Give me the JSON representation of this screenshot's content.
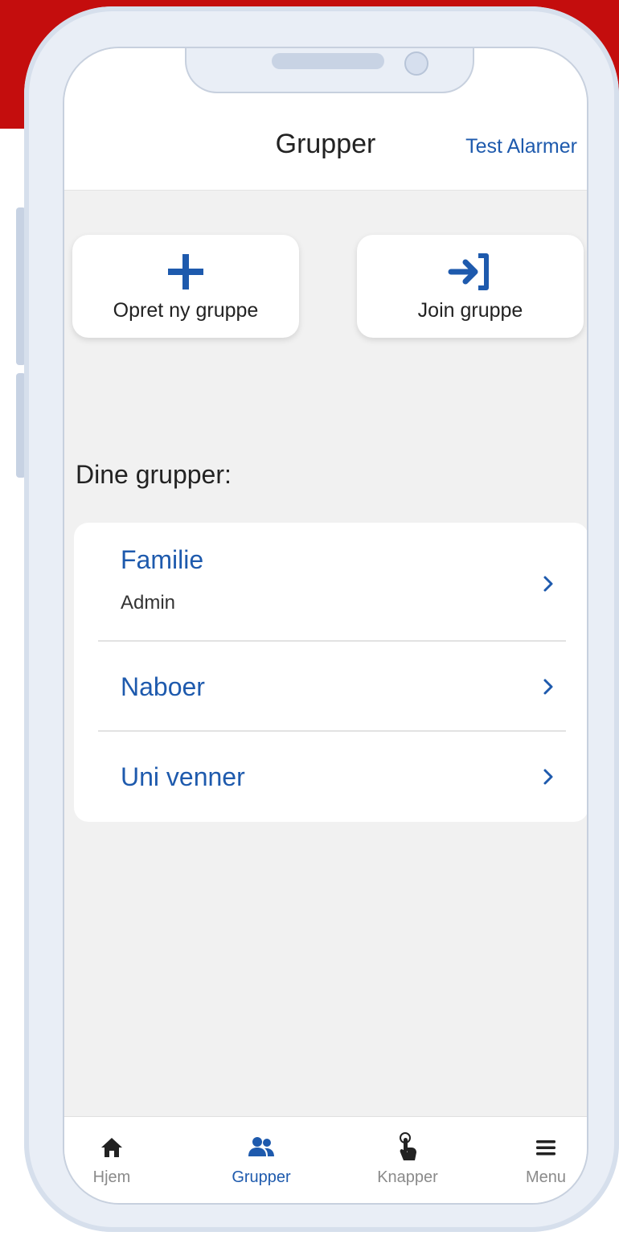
{
  "colors": {
    "brand_red": "#c40d0d",
    "accent_blue": "#1e5aad",
    "screen_bg": "#f1f1f1",
    "tab_inactive": "#8a8a8a"
  },
  "header": {
    "title": "Grupper",
    "right_link": "Test Alarmer"
  },
  "actions": {
    "create": {
      "icon": "plus-icon",
      "label": "Opret ny gruppe"
    },
    "join": {
      "icon": "login-arrow-icon",
      "label": "Join gruppe"
    }
  },
  "groups": {
    "section_title": "Dine grupper:",
    "items": [
      {
        "name": "Familie",
        "role": "Admin",
        "icon": "chevron-right-icon"
      },
      {
        "name": "Naboer",
        "icon": "chevron-right-icon"
      },
      {
        "name": "Uni venner",
        "icon": "chevron-right-icon"
      }
    ]
  },
  "tabbar": {
    "items": [
      {
        "label": "Hjem",
        "icon": "home-icon",
        "active": false
      },
      {
        "label": "Grupper",
        "icon": "people-icon",
        "active": true
      },
      {
        "label": "Knapper",
        "icon": "hand-pointer-icon",
        "active": false
      },
      {
        "label": "Menu",
        "icon": "hamburger-menu-icon",
        "active": false
      }
    ]
  }
}
